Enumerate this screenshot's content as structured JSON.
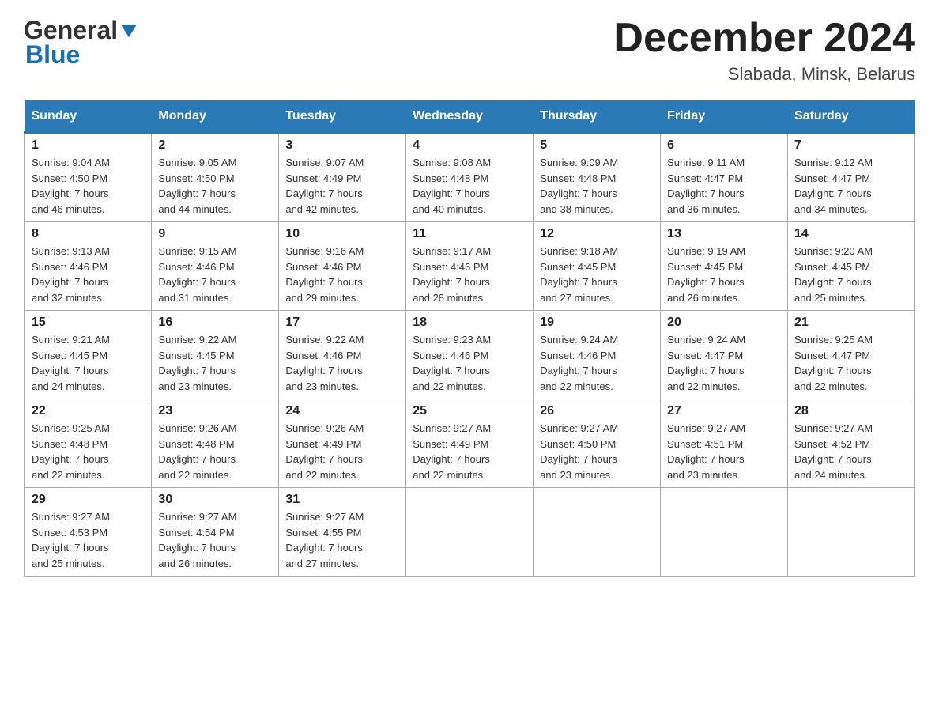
{
  "header": {
    "logo_general": "General",
    "logo_blue": "Blue",
    "month_title": "December 2024",
    "location": "Slabada, Minsk, Belarus"
  },
  "days_of_week": [
    "Sunday",
    "Monday",
    "Tuesday",
    "Wednesday",
    "Thursday",
    "Friday",
    "Saturday"
  ],
  "weeks": [
    [
      {
        "day": "1",
        "info": "Sunrise: 9:04 AM\nSunset: 4:50 PM\nDaylight: 7 hours\nand 46 minutes."
      },
      {
        "day": "2",
        "info": "Sunrise: 9:05 AM\nSunset: 4:50 PM\nDaylight: 7 hours\nand 44 minutes."
      },
      {
        "day": "3",
        "info": "Sunrise: 9:07 AM\nSunset: 4:49 PM\nDaylight: 7 hours\nand 42 minutes."
      },
      {
        "day": "4",
        "info": "Sunrise: 9:08 AM\nSunset: 4:48 PM\nDaylight: 7 hours\nand 40 minutes."
      },
      {
        "day": "5",
        "info": "Sunrise: 9:09 AM\nSunset: 4:48 PM\nDaylight: 7 hours\nand 38 minutes."
      },
      {
        "day": "6",
        "info": "Sunrise: 9:11 AM\nSunset: 4:47 PM\nDaylight: 7 hours\nand 36 minutes."
      },
      {
        "day": "7",
        "info": "Sunrise: 9:12 AM\nSunset: 4:47 PM\nDaylight: 7 hours\nand 34 minutes."
      }
    ],
    [
      {
        "day": "8",
        "info": "Sunrise: 9:13 AM\nSunset: 4:46 PM\nDaylight: 7 hours\nand 32 minutes."
      },
      {
        "day": "9",
        "info": "Sunrise: 9:15 AM\nSunset: 4:46 PM\nDaylight: 7 hours\nand 31 minutes."
      },
      {
        "day": "10",
        "info": "Sunrise: 9:16 AM\nSunset: 4:46 PM\nDaylight: 7 hours\nand 29 minutes."
      },
      {
        "day": "11",
        "info": "Sunrise: 9:17 AM\nSunset: 4:46 PM\nDaylight: 7 hours\nand 28 minutes."
      },
      {
        "day": "12",
        "info": "Sunrise: 9:18 AM\nSunset: 4:45 PM\nDaylight: 7 hours\nand 27 minutes."
      },
      {
        "day": "13",
        "info": "Sunrise: 9:19 AM\nSunset: 4:45 PM\nDaylight: 7 hours\nand 26 minutes."
      },
      {
        "day": "14",
        "info": "Sunrise: 9:20 AM\nSunset: 4:45 PM\nDaylight: 7 hours\nand 25 minutes."
      }
    ],
    [
      {
        "day": "15",
        "info": "Sunrise: 9:21 AM\nSunset: 4:45 PM\nDaylight: 7 hours\nand 24 minutes."
      },
      {
        "day": "16",
        "info": "Sunrise: 9:22 AM\nSunset: 4:45 PM\nDaylight: 7 hours\nand 23 minutes."
      },
      {
        "day": "17",
        "info": "Sunrise: 9:22 AM\nSunset: 4:46 PM\nDaylight: 7 hours\nand 23 minutes."
      },
      {
        "day": "18",
        "info": "Sunrise: 9:23 AM\nSunset: 4:46 PM\nDaylight: 7 hours\nand 22 minutes."
      },
      {
        "day": "19",
        "info": "Sunrise: 9:24 AM\nSunset: 4:46 PM\nDaylight: 7 hours\nand 22 minutes."
      },
      {
        "day": "20",
        "info": "Sunrise: 9:24 AM\nSunset: 4:47 PM\nDaylight: 7 hours\nand 22 minutes."
      },
      {
        "day": "21",
        "info": "Sunrise: 9:25 AM\nSunset: 4:47 PM\nDaylight: 7 hours\nand 22 minutes."
      }
    ],
    [
      {
        "day": "22",
        "info": "Sunrise: 9:25 AM\nSunset: 4:48 PM\nDaylight: 7 hours\nand 22 minutes."
      },
      {
        "day": "23",
        "info": "Sunrise: 9:26 AM\nSunset: 4:48 PM\nDaylight: 7 hours\nand 22 minutes."
      },
      {
        "day": "24",
        "info": "Sunrise: 9:26 AM\nSunset: 4:49 PM\nDaylight: 7 hours\nand 22 minutes."
      },
      {
        "day": "25",
        "info": "Sunrise: 9:27 AM\nSunset: 4:49 PM\nDaylight: 7 hours\nand 22 minutes."
      },
      {
        "day": "26",
        "info": "Sunrise: 9:27 AM\nSunset: 4:50 PM\nDaylight: 7 hours\nand 23 minutes."
      },
      {
        "day": "27",
        "info": "Sunrise: 9:27 AM\nSunset: 4:51 PM\nDaylight: 7 hours\nand 23 minutes."
      },
      {
        "day": "28",
        "info": "Sunrise: 9:27 AM\nSunset: 4:52 PM\nDaylight: 7 hours\nand 24 minutes."
      }
    ],
    [
      {
        "day": "29",
        "info": "Sunrise: 9:27 AM\nSunset: 4:53 PM\nDaylight: 7 hours\nand 25 minutes."
      },
      {
        "day": "30",
        "info": "Sunrise: 9:27 AM\nSunset: 4:54 PM\nDaylight: 7 hours\nand 26 minutes."
      },
      {
        "day": "31",
        "info": "Sunrise: 9:27 AM\nSunset: 4:55 PM\nDaylight: 7 hours\nand 27 minutes."
      },
      {
        "day": "",
        "info": ""
      },
      {
        "day": "",
        "info": ""
      },
      {
        "day": "",
        "info": ""
      },
      {
        "day": "",
        "info": ""
      }
    ]
  ]
}
